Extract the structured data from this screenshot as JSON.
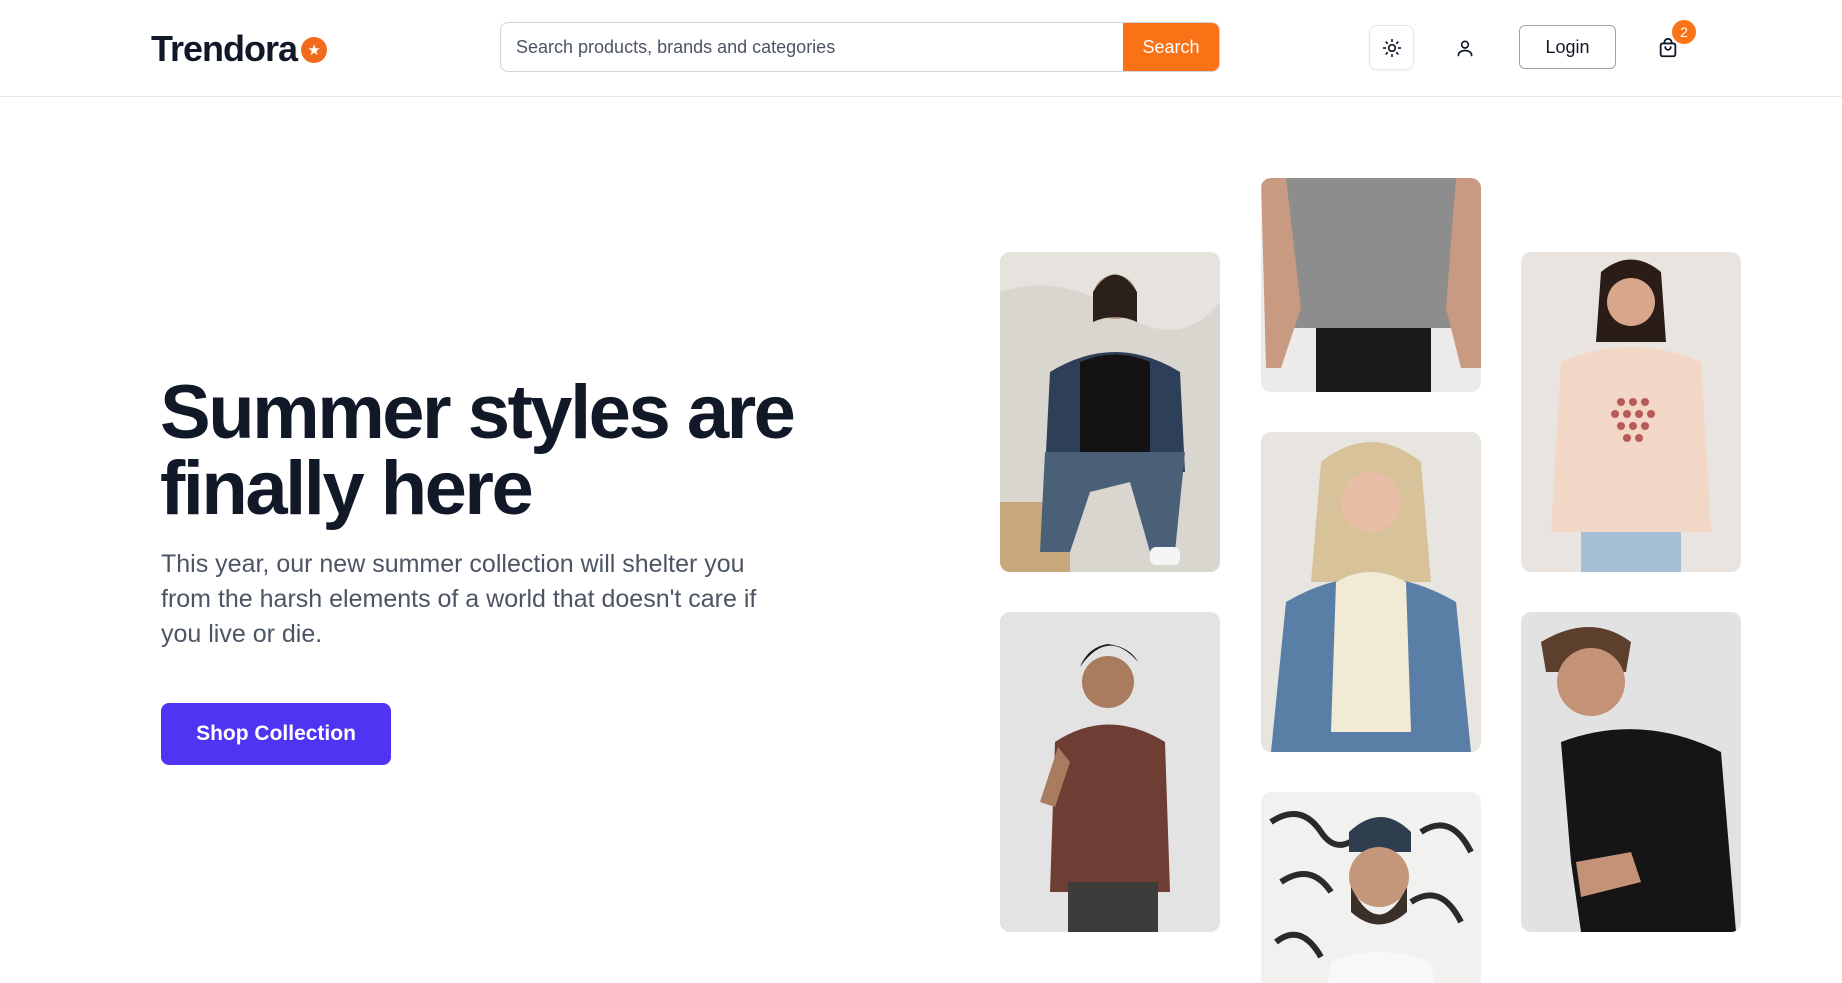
{
  "header": {
    "logo_text": "Trendora",
    "logo_badge_icon": "star-icon",
    "search": {
      "placeholder": "Search products, brands and categories",
      "button_label": "Search"
    },
    "theme_toggle_icon": "sun-icon",
    "account_icon": "user-icon",
    "login_label": "Login",
    "cart_icon": "shopping-bag-icon",
    "cart_count": "2"
  },
  "hero": {
    "title": "Summer styles are finally here",
    "subtitle": "This year, our new summer collection will shelter you from the harsh elements of a world that doesn't care if you live or die.",
    "cta_label": "Shop Collection"
  },
  "gallery": [
    {
      "subject": "woman-denim-jacket-black-tee"
    },
    {
      "subject": "man-grey-tee-torso"
    },
    {
      "subject": "woman-pink-graphic-tee"
    },
    {
      "subject": "man-brown-tee"
    },
    {
      "subject": "woman-cream-tee-denim-jacket"
    },
    {
      "subject": "man-black-tee"
    },
    {
      "subject": "man-beanie-glasses"
    }
  ],
  "colors": {
    "accent_orange": "#f97316",
    "cta_purple": "#4f35f3",
    "text_dark": "#111827",
    "text_muted": "#4b5563"
  }
}
